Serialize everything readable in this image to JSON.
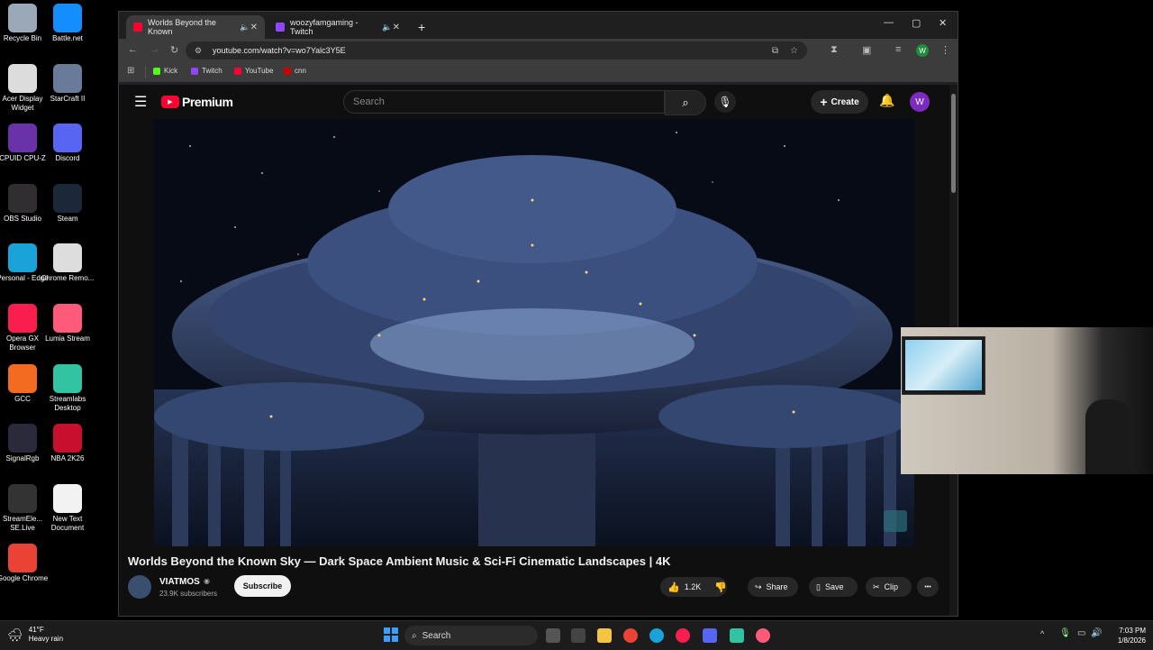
{
  "desktop": {
    "icons": [
      {
        "label": "Recycle Bin",
        "icon": "recycle-bin-icon",
        "color": "#9aa8b8"
      },
      {
        "label": "Battle.net",
        "icon": "battlenet-icon",
        "color": "#148eff"
      },
      {
        "label": "Acer Display Widget",
        "icon": "acer-widget-icon",
        "color": "#dcdcdc"
      },
      {
        "label": "StarCraft II",
        "icon": "starcraft-icon",
        "color": "#6a7a9a"
      },
      {
        "label": "CPUID CPU-Z",
        "icon": "cpuz-icon",
        "color": "#6a32a8"
      },
      {
        "label": "Discord",
        "icon": "discord-icon",
        "color": "#5865f2"
      },
      {
        "label": "OBS Studio",
        "icon": "obs-icon",
        "color": "#302e31"
      },
      {
        "label": "Steam",
        "icon": "steam-icon",
        "color": "#1b2838"
      },
      {
        "label": "Personal - Edge",
        "icon": "edge-icon",
        "color": "#1aa3d8"
      },
      {
        "label": "Chrome Remo...",
        "icon": "chrome-remote-icon",
        "color": "#dddddd"
      },
      {
        "label": "Opera GX Browser",
        "icon": "operagx-icon",
        "color": "#fa1e4e"
      },
      {
        "label": "Lumia Stream",
        "icon": "lumia-icon",
        "color": "#ff5a7a"
      },
      {
        "label": "GCC",
        "icon": "gcc-icon",
        "color": "#f26b21"
      },
      {
        "label": "Streamlabs Desktop",
        "icon": "streamlabs-icon",
        "color": "#31c3a2"
      },
      {
        "label": "SignalRgb",
        "icon": "signalrgb-icon",
        "color": "#2a2a3a"
      },
      {
        "label": "NBA 2K26",
        "icon": "nba2k-icon",
        "color": "#c8102e"
      },
      {
        "label": "StreamEle... SE.Live",
        "icon": "streamelements-icon",
        "color": "#333333"
      },
      {
        "label": "New Text Document",
        "icon": "text-document-icon",
        "color": "#f2f2f2"
      },
      {
        "label": "Google Chrome",
        "icon": "chrome-icon",
        "color": "#ea4335"
      }
    ]
  },
  "browser": {
    "tabs": [
      {
        "title": "Worlds Beyond the Known",
        "active": true,
        "favicon": "youtube-favicon",
        "color": "#ff0033"
      },
      {
        "title": "woozyfamgaming - Twitch",
        "active": false,
        "favicon": "twitch-favicon",
        "color": "#9146ff"
      }
    ],
    "new_tab": "+",
    "url": "youtube.com/watch?v=wo7Yalc3Y5E",
    "profile_initial": "W",
    "bookmarks": [
      {
        "label": "Kick",
        "color": "#53fc18"
      },
      {
        "label": "Twitch",
        "color": "#9146ff"
      },
      {
        "label": "YouTube",
        "color": "#ff0033"
      },
      {
        "label": "cnn",
        "color": "#cc0000"
      }
    ]
  },
  "youtube": {
    "logo_text": "Premium",
    "search_placeholder": "Search",
    "create_label": "Create",
    "avatar_initial": "W",
    "video_title": "Worlds Beyond the Known Sky — Dark Space Ambient Music & Sci-Fi Cinematic Landscapes | 4K",
    "channel": {
      "name": "VIATMOS",
      "subscribers": "23.9K subscribers",
      "subscribe_label": "Subscribe"
    },
    "actions": {
      "likes": "1.2K",
      "share": "Share",
      "save": "Save",
      "clip": "Clip",
      "more": "•••"
    }
  },
  "taskbar": {
    "weather_temp": "41°F",
    "weather_text": "Heavy rain",
    "search_label": "Search",
    "time": "7:03 PM",
    "date": "1/8/2026"
  }
}
